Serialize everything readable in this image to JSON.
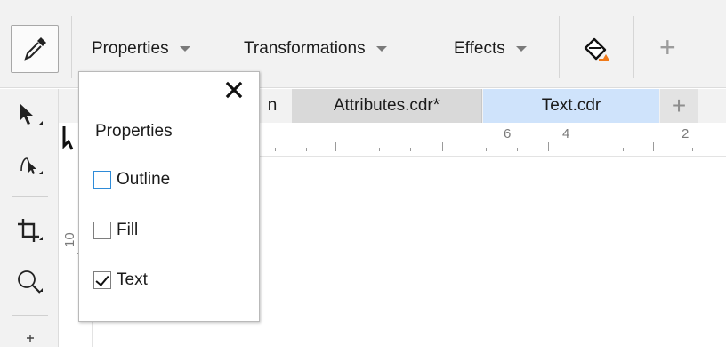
{
  "propbar": {
    "menus": [
      {
        "label": "Properties"
      },
      {
        "label": "Transformations"
      },
      {
        "label": "Effects"
      }
    ],
    "add_symbol": "+"
  },
  "tabs": {
    "partial_label": "n",
    "items": [
      {
        "label": "Attributes.cdr*",
        "active": false
      },
      {
        "label": "Text.cdr",
        "active": true
      }
    ],
    "add_symbol": "+"
  },
  "ruler": {
    "h_labels": [
      "6",
      "4",
      "2"
    ],
    "v_labels": [
      "10"
    ]
  },
  "popup": {
    "close_symbol": "✕",
    "title": "Properties",
    "options": [
      {
        "label": "Outline",
        "checked": false,
        "focused": true
      },
      {
        "label": "Fill",
        "checked": false,
        "focused": false
      },
      {
        "label": "Text",
        "checked": true,
        "focused": false
      }
    ]
  },
  "colors": {
    "active_tab": "#cfe3fb",
    "inactive_tab": "#d9d9d9",
    "accent_orange": "#f07a1a",
    "focus_blue": "#2e8bd8"
  }
}
